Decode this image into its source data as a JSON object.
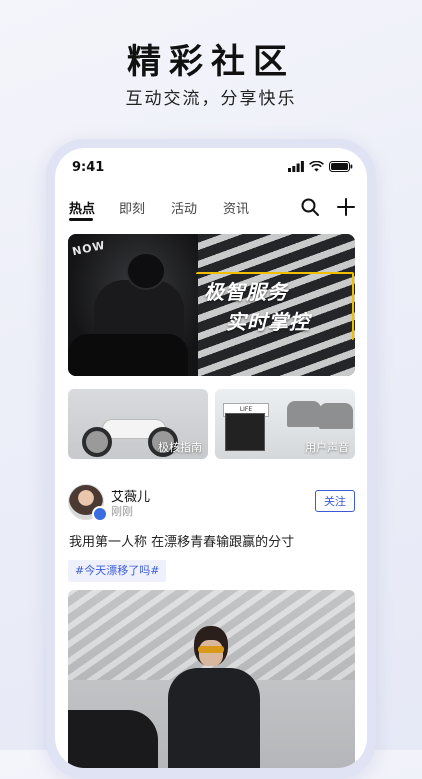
{
  "header": {
    "title": "精彩社区",
    "subtitle": "互动交流，分享快乐"
  },
  "status_bar": {
    "time": "9:41"
  },
  "nav": {
    "tabs": [
      {
        "label": "热点",
        "active": true
      },
      {
        "label": "即刻",
        "active": false
      },
      {
        "label": "活动",
        "active": false
      },
      {
        "label": "资讯",
        "active": false
      }
    ],
    "search_icon": "search-icon",
    "add_icon": "plus-icon"
  },
  "banner": {
    "tag": "NOW",
    "line1": "极智服务",
    "line2": "实时掌控"
  },
  "cards": [
    {
      "label": "极核指南"
    },
    {
      "label": "用户声音",
      "sign": "LIFE"
    }
  ],
  "post": {
    "username": "艾薇儿",
    "time": "刚刚",
    "follow_label": "关注",
    "text": "我用第一人称 在漂移青春输跟赢的分寸",
    "hashtag": "#今天漂移了吗#"
  },
  "colors": {
    "accent": "#3d5bd6",
    "banner_frame": "#f0c000"
  }
}
